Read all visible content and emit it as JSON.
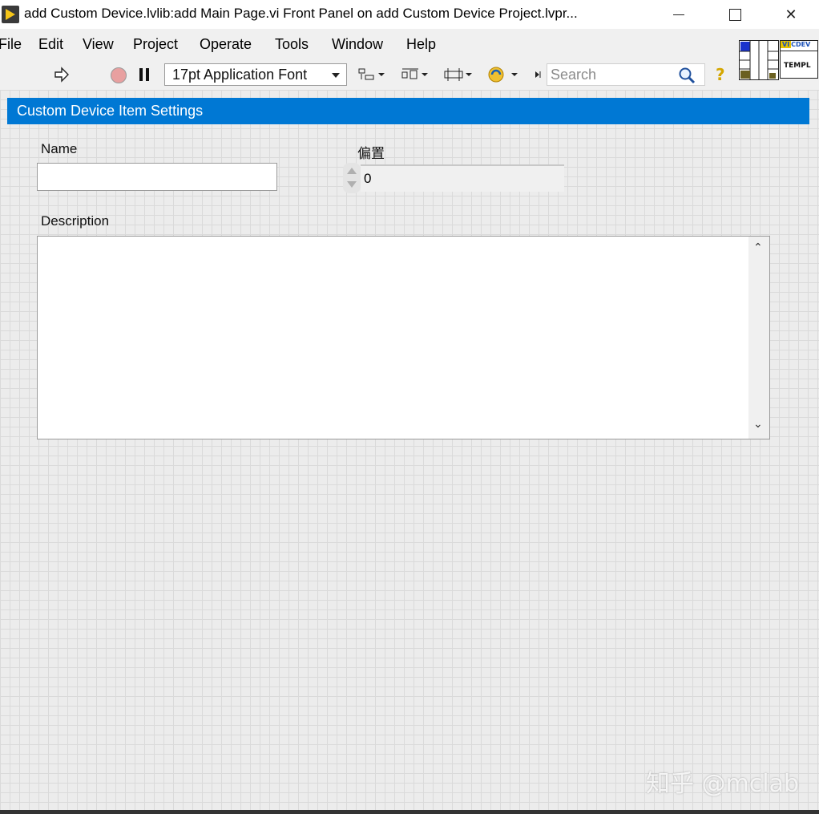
{
  "window": {
    "title": "add Custom Device.lvlib:add Main Page.vi Front Panel on add Custom Device Project.lvpr...",
    "minimize_icon": "minimize-icon",
    "maximize_icon": "maximize-icon",
    "close_icon": "close-icon"
  },
  "menu": [
    "File",
    "Edit",
    "View",
    "Project",
    "Operate",
    "Tools",
    "Window",
    "Help"
  ],
  "toolbar": {
    "font": "17pt Application Font",
    "search_placeholder": "Search",
    "run_icon": "run-arrow-icon",
    "stop_icon": "abort-icon",
    "pause_icon": "pause-icon",
    "help_icon": "help-icon"
  },
  "vi_icon": {
    "top": "CDEV",
    "label": "TEMPL"
  },
  "panel": {
    "header": "Custom Device Item Settings",
    "name_label": "Name",
    "name_value": "",
    "offset_label": "偏置",
    "offset_value": "0",
    "description_label": "Description",
    "description_value": ""
  },
  "watermark": "知乎 @mclab",
  "colors": {
    "header_blue": "#0078d4",
    "panel_bg": "#ececec"
  }
}
